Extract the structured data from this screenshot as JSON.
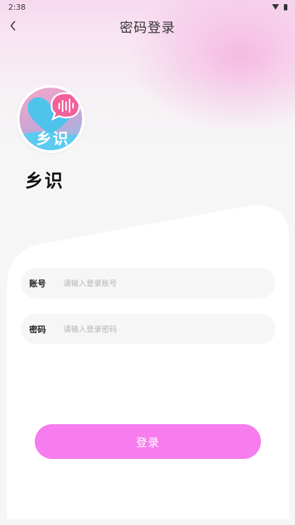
{
  "status_bar": {
    "time": "2:38"
  },
  "header": {
    "title": "密码登录"
  },
  "logo": {
    "text": "乡识"
  },
  "app": {
    "name": "乡识"
  },
  "form": {
    "account": {
      "label": "账号",
      "placeholder": "请输入登录账号"
    },
    "password": {
      "label": "密码",
      "placeholder": "请输入登录密码"
    },
    "submit_label": "登录"
  },
  "colors": {
    "accent": "#f77ced",
    "background": "#f6f6f7",
    "logo_heart": "#4ec4ec",
    "logo_bubble": "#f2609a"
  },
  "icons": [
    "wifi-icon",
    "battery-icon",
    "back-chevron-icon",
    "app-logo-icon"
  ]
}
